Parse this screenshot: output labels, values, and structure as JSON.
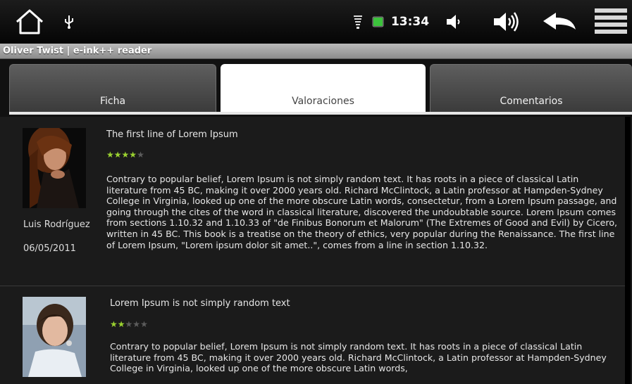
{
  "status_bar": {
    "time": "13:34",
    "icons": [
      "home-icon",
      "usb-icon",
      "wifi-icon",
      "battery-icon",
      "volume-down-icon",
      "volume-up-icon",
      "back-icon",
      "menu-icon"
    ],
    "battery_color": "#3cc33c"
  },
  "title_bar": {
    "title": "Oliver Twist | e-ink++ reader"
  },
  "tabs": [
    {
      "label": "Ficha",
      "selected": false
    },
    {
      "label": "Valoraciones",
      "selected": true
    },
    {
      "label": "Comentarios",
      "selected": false
    }
  ],
  "reviews": [
    {
      "title": "The first line of Lorem Ipsum",
      "rating": 4,
      "max_rating": 5,
      "author": "Luis Rodríguez",
      "date": "06/05/2011",
      "text": "Contrary to popular belief, Lorem Ipsum is not simply random text. It has roots in a piece of classical Latin literature from 45 BC, making it over 2000 years old. Richard McClintock, a Latin professor at Hampden-Sydney College in Virginia, looked up one of the more obscure Latin words, consectetur, from a Lorem Ipsum passage, and going through the cites of the word in classical literature, discovered the undoubtable source. Lorem Ipsum comes from sections 1.10.32 and 1.10.33 of \"de Finibus Bonorum et Malorum\" (The Extremes of Good and Evil) by Cicero, written in 45 BC. This book is a treatise on the theory of ethics, very popular during the Renaissance. The first line of Lorem Ipsum, \"Lorem ipsum dolor sit amet..\", comes from a line in section 1.10.32."
    },
    {
      "title": "Lorem Ipsum is not simply random text",
      "rating": 2,
      "max_rating": 5,
      "text": "Contrary to popular belief, Lorem Ipsum is not simply random text. It has roots in a piece of classical Latin literature from 45 BC, making it over 2000 years old. Richard McClintock, a Latin professor at Hampden-Sydney College in Virginia, looked up one of the more obscure Latin words,"
    }
  ],
  "colors": {
    "star_on": "#9bd230",
    "star_off": "#5c5c5c",
    "selected_tab": "#ffffff",
    "content_bg": "#1b1b1b"
  }
}
